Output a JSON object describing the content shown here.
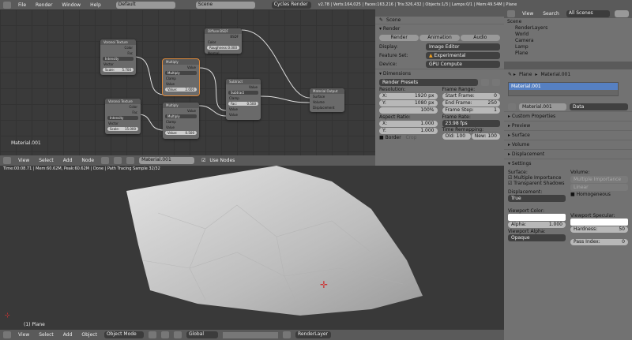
{
  "topbar": {
    "menus": [
      "File",
      "Render",
      "Window",
      "Help"
    ],
    "layout": "Default",
    "scene": "Scene",
    "engine": "Cycles Render",
    "stats": "v2.78 | Verts:164,025 | Faces:163,216 | Tris:326,432 | Objects:1/3 | Lamps:0/1 | Mem:49.54M | Plane"
  },
  "nodes": [
    {
      "title": "Voronoi Texture",
      "rows": [
        "Color",
        "Fac"
      ],
      "sel": "Intensity",
      "inputs": [
        "Vector"
      ],
      "val": [
        "Scale:",
        "5.700"
      ]
    },
    {
      "title": "Voronoi Texture",
      "rows": [
        "Color",
        "Fac"
      ],
      "sel": "Intensity",
      "inputs": [
        "Vector"
      ],
      "val": [
        "Scale:",
        "15.000"
      ]
    },
    {
      "title": "Multiply",
      "rows": [
        "Value"
      ],
      "sel": "Multiply",
      "check": "Clamp",
      "inputs": [
        "Value"
      ],
      "val": [
        "Value:",
        "2.000"
      ]
    },
    {
      "title": "Multiply",
      "rows": [
        "Value"
      ],
      "sel": "Multiply",
      "check": "Clamp",
      "inputs": [
        "Value"
      ],
      "val": [
        "Value:",
        "0.500"
      ]
    },
    {
      "title": "Diffuse BSDF",
      "rows": [
        "BSDF"
      ],
      "inputs": [
        "Color",
        "Normal"
      ],
      "val": [
        "Roughness:",
        "0.000"
      ]
    },
    {
      "title": "Subtract",
      "rows": [
        "Value"
      ],
      "sel": "Subtract",
      "check": "Clamp",
      "inputs": [
        "Value",
        "Value"
      ],
      "val": [
        "Fac:",
        "0.500"
      ]
    },
    {
      "title": "Material Output",
      "rows": [],
      "inputs": [
        "Surface",
        "Volume",
        "Displacement"
      ]
    }
  ],
  "node_label": "Material.001",
  "node_header": {
    "menus": [
      "View",
      "Select",
      "Add",
      "Node"
    ],
    "material": "Material.001",
    "use_nodes": "Use Nodes"
  },
  "status": "Time:00:08.71 | Mem:60.62M, Peak:60.62M | Done | Path Tracing Sample 32/32",
  "viewport": {
    "object": "(1) Plane",
    "menus": [
      "View",
      "Select",
      "Add",
      "Object"
    ],
    "mode": "Object Mode",
    "orientation": "Global",
    "layer": "RenderLayer"
  },
  "render": {
    "breadcrumb": "Scene",
    "section": "Render",
    "buttons": [
      "Render",
      "Animation",
      "Audio"
    ],
    "display_label": "Display:",
    "display": "Image Editor",
    "feature_label": "Feature Set:",
    "feature": "Experimental",
    "device_label": "Device:",
    "device": "GPU Compute",
    "dimensions": "Dimensions",
    "presets": "Render Presets",
    "resolution": "Resolution:",
    "res_x": [
      "X:",
      "1920 px"
    ],
    "res_y": [
      "Y:",
      "1080 px"
    ],
    "res_pct": "100%",
    "frame_range": "Frame Range:",
    "start": [
      "Start Frame:",
      "0"
    ],
    "end": [
      "End Frame:",
      "250"
    ],
    "step": [
      "Frame Step:",
      "1"
    ],
    "aspect": "Aspect Ratio:",
    "asp_x": [
      "X:",
      "1.000"
    ],
    "asp_y": [
      "Y:",
      "1.000"
    ],
    "frame_rate": "Frame Rate:",
    "fps": "23.98 fps",
    "remap": "Time Remapping:",
    "old": "Old: 100",
    "new": "New: 100",
    "border": "Border",
    "crop": "Crop"
  },
  "outliner": {
    "menus": [
      "View",
      "Search"
    ],
    "filter": "All Scenes",
    "items": [
      "Scene",
      "RenderLayers",
      "World",
      "Camera",
      "Lamp",
      "Plane"
    ]
  },
  "material": {
    "breadcrumb": [
      "Plane",
      "Material.001"
    ],
    "slot": "Material.001",
    "name": "Material.001",
    "link": "Data",
    "panels": [
      "Custom Properties",
      "Preview",
      "Surface",
      "Volume",
      "Displacement",
      "Settings"
    ],
    "surface": "Surface:",
    "mult_imp": "Multiple Importance",
    "trans_shadows": "Transparent Shadows",
    "volume": "Volume:",
    "vol_sampling": "Multiple Importance",
    "vol_interp": "Linear",
    "homogeneous": "Homogeneous",
    "displacement": "Displacement:",
    "disp": "True",
    "vp_color": "Viewport Color:",
    "alpha": [
      "Alpha:",
      "1.000"
    ],
    "vp_spec": "Viewport Specular:",
    "hardness": [
      "Hardness:",
      "50"
    ],
    "vp_alpha": "Viewport Alpha:",
    "opaque": "Opaque",
    "pass_index": [
      "Pass Index:",
      "0"
    ]
  }
}
